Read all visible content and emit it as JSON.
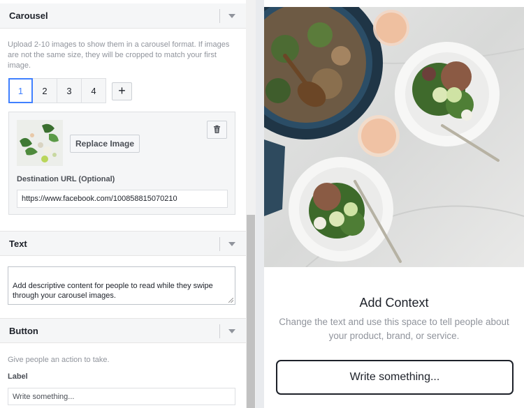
{
  "carousel": {
    "title": "Carousel",
    "description": "Upload 2-10 images to show them in a carousel format. If images are not the same size, they will be cropped to match your first image.",
    "tabs": [
      "1",
      "2",
      "3",
      "4"
    ],
    "active_tab": "1",
    "add_label": "+",
    "card": {
      "replace_label": "Replace Image",
      "destination_label": "Destination URL (Optional)",
      "destination_value": "https://www.facebook.com/100858815070210"
    }
  },
  "text_section": {
    "title": "Text",
    "textarea_value": "Add descriptive content for people to read while they swipe through your carousel images."
  },
  "button_section": {
    "title": "Button",
    "description": "Give people an action to take.",
    "label_label": "Label",
    "label_value": "Write something..."
  },
  "preview": {
    "context_title": "Add Context",
    "context_description": "Change the text and use this space to tell people about your product, brand, or service.",
    "cta_label": "Write something..."
  },
  "colors": {
    "accent": "#4080ff",
    "header_bg": "#f5f6f7",
    "muted_text": "#90949c"
  },
  "icons": [
    "chevron-down-icon",
    "trash-icon",
    "plus-icon"
  ]
}
